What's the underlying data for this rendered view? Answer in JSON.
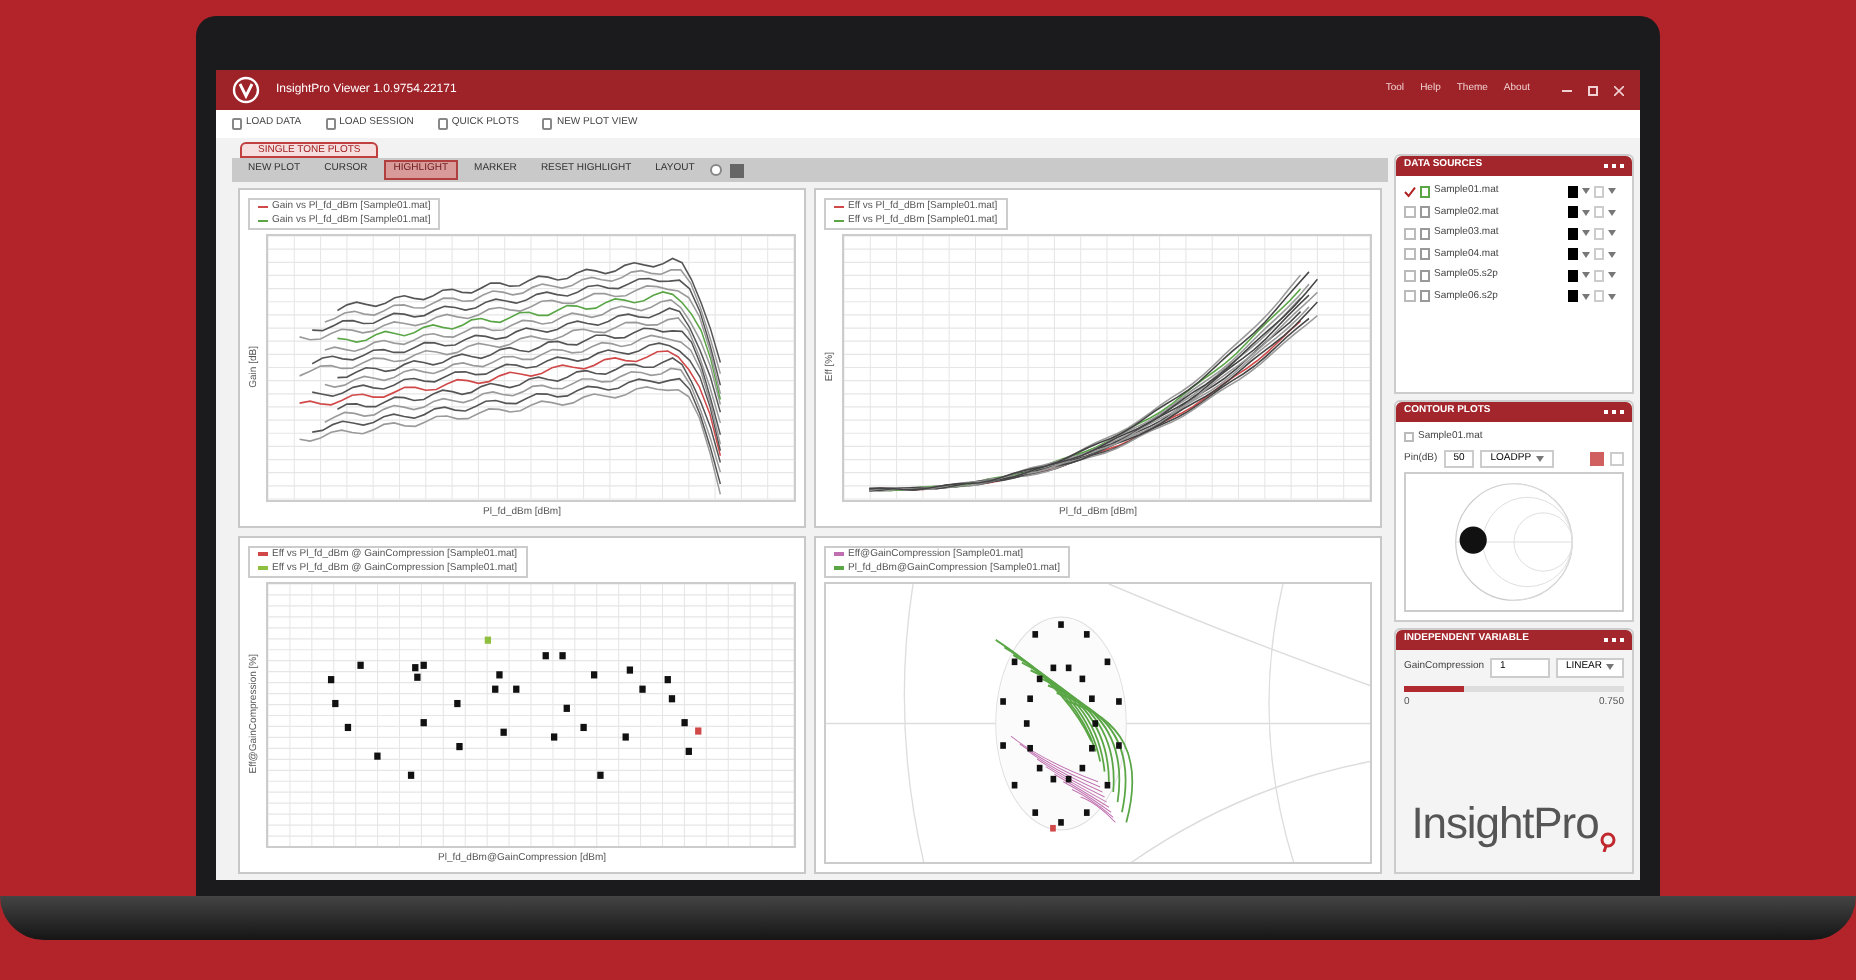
{
  "window": {
    "title": "InsightPro Viewer 1.0.9754.22171",
    "menu": [
      "Tool",
      "Help",
      "Theme",
      "About"
    ]
  },
  "toolbar": [
    {
      "label": "LOAD DATA"
    },
    {
      "label": "LOAD SESSION"
    },
    {
      "label": "QUICK PLOTS"
    },
    {
      "label": "NEW PLOT VIEW"
    }
  ],
  "document_tab": {
    "label": "SINGLE TONE PLOTS",
    "selected": true
  },
  "plot_toolbar": [
    {
      "label": "NEW PLOT",
      "selected": false
    },
    {
      "label": "CURSOR",
      "selected": false
    },
    {
      "label": "HIGHLIGHT",
      "selected": true
    },
    {
      "label": "MARKER",
      "selected": false
    },
    {
      "label": "RESET HIGHLIGHT",
      "selected": false
    },
    {
      "label": "LAYOUT",
      "selected": false
    }
  ],
  "plots": [
    {
      "kind": "gain",
      "legend": [
        {
          "label": "Gain vs Pl_fd_dBm [Sample01.mat]",
          "color": "#d04848"
        },
        {
          "label": "Gain vs Pl_fd_dBm [Sample01.mat]",
          "color": "#5aa646"
        }
      ],
      "xlabel": "Pl_fd_dBm [dBm]",
      "ylabel": "Gain [dB]"
    },
    {
      "kind": "power",
      "legend": [
        {
          "label": "Eff vs Pl_fd_dBm [Sample01.mat]",
          "color": "#d04848"
        },
        {
          "label": "Eff vs Pl_fd_dBm [Sample01.mat]",
          "color": "#5aa646"
        }
      ],
      "xlabel": "Pl_fd_dBm [dBm]",
      "ylabel": "Eff [%]"
    },
    {
      "kind": "scatter",
      "legend": [
        {
          "label": "Eff vs Pl_fd_dBm @ GainCompression [Sample01.mat]",
          "color": "#d04848"
        },
        {
          "label": "Eff vs Pl_fd_dBm @ GainCompression [Sample01.mat]",
          "color": "#8fbf3f"
        }
      ],
      "xlabel": "Pl_fd_dBm@GainCompression [dBm]",
      "ylabel": "Eff@GainCompression [%]"
    },
    {
      "kind": "smith",
      "legend": [
        {
          "label": "Eff@GainCompression [Sample01.mat]",
          "color": "#c070b0"
        },
        {
          "label": "Pl_fd_dBm@GainCompression [Sample01.mat]",
          "color": "#5aa646"
        }
      ]
    }
  ],
  "data_sources": {
    "title": "DATA SOURCES",
    "items": [
      {
        "name": "Sample01.mat",
        "checked": true
      },
      {
        "name": "Sample02.mat",
        "checked": false
      },
      {
        "name": "Sample03.mat",
        "checked": false
      },
      {
        "name": "Sample04.mat",
        "checked": false
      },
      {
        "name": "Sample05.s2p",
        "checked": false
      },
      {
        "name": "Sample06.s2p",
        "checked": false
      }
    ]
  },
  "contours": {
    "title": "CONTOUR PLOTS",
    "source": "Sample01.mat",
    "checked": false,
    "field_label": "Pin(dB)",
    "field_value": "50",
    "mode": "LOADPP"
  },
  "independent_variable": {
    "title": "INDEPENDENT VARIABLE",
    "name": "GainCompression",
    "value": "1",
    "scale": "LINEAR",
    "level": 0.27,
    "min": "0",
    "max": "0.750"
  },
  "logo": {
    "text": "InsightPro"
  }
}
